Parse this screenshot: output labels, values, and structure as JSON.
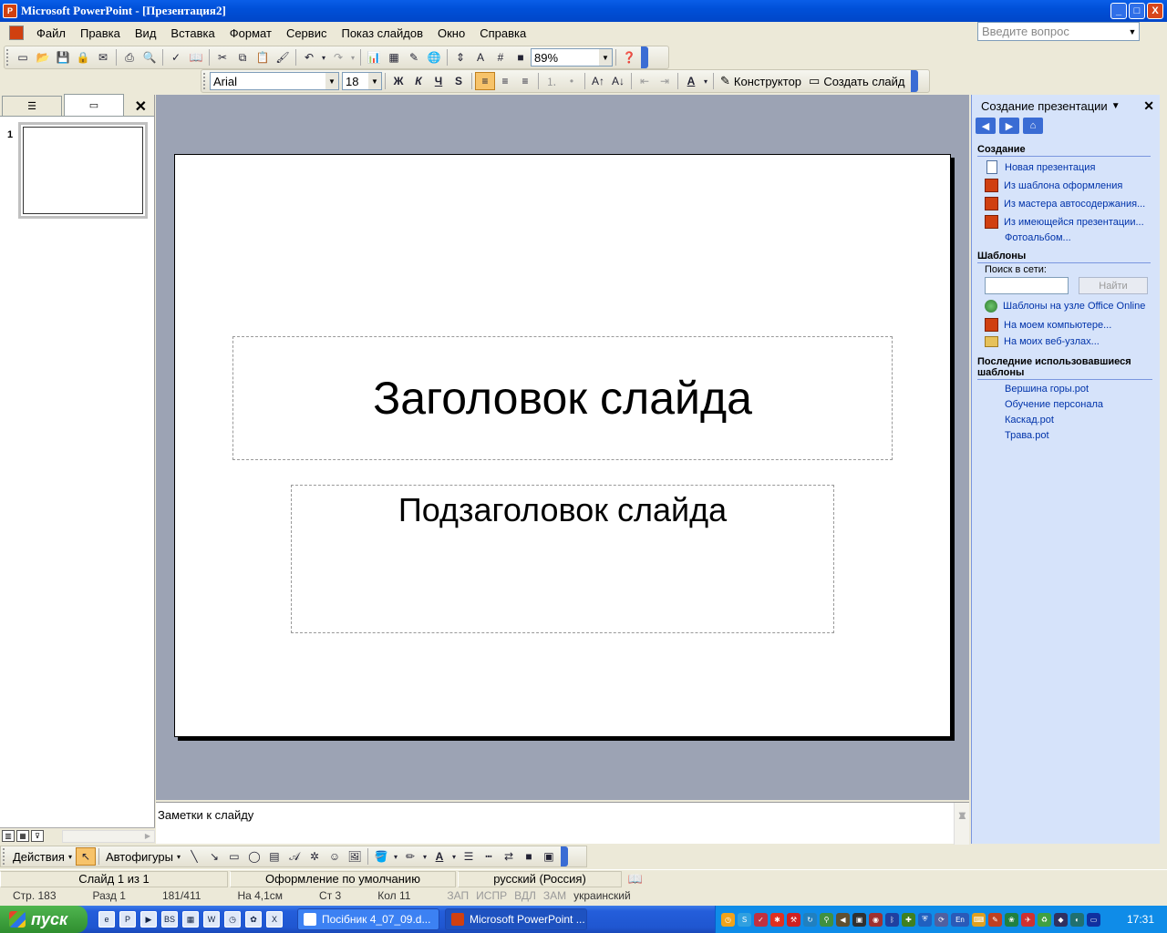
{
  "window": {
    "title": "Microsoft PowerPoint - [Презентация2]",
    "min_label": "_",
    "max_label": "□",
    "close_label": "X"
  },
  "menu": {
    "items": [
      "Файл",
      "Правка",
      "Вид",
      "Вставка",
      "Формат",
      "Сервис",
      "Показ слайдов",
      "Окно",
      "Справка"
    ],
    "ask_placeholder": "Введите вопрос"
  },
  "standard_toolbar": {
    "zoom": "89%"
  },
  "format_toolbar": {
    "font": "Arial",
    "font_size": "18",
    "bold": "Ж",
    "italic": "К",
    "underline": "Ч",
    "shadow": "S",
    "designer": "Конструктор",
    "new_slide": "Создать слайд"
  },
  "outline_pane": {
    "slide_number": "1"
  },
  "slide": {
    "title": "Заголовок слайда",
    "subtitle": "Подзаголовок слайда"
  },
  "notes": {
    "placeholder": "Заметки к слайду"
  },
  "task_pane": {
    "title": "Создание презентации",
    "section_create": "Создание",
    "create_links": [
      "Новая презентация",
      "Из шаблона оформления",
      "Из мастера автосодержания...",
      "Из имеющейся презентации...",
      "Фотоальбом..."
    ],
    "section_templates": "Шаблоны",
    "search_label": "Поиск в сети:",
    "search_button": "Найти",
    "template_links": [
      "Шаблоны на узле Office Online",
      "На моем компьютере...",
      "На моих веб-узлах..."
    ],
    "section_recent": "Последние использовавшиеся шаблоны",
    "recent_links": [
      "Вершина горы.pot",
      "Обучение персонала",
      "Каскад.pot",
      "Трава.pot"
    ]
  },
  "draw_toolbar": {
    "actions": "Действия",
    "autoshapes": "Автофигуры"
  },
  "status_bar": {
    "slide_pos": "Слайд 1 из 1",
    "design": "Оформление по умолчанию",
    "language": "русский (Россия)"
  },
  "background_status": {
    "items": [
      "Стр. 183",
      "Разд 1",
      "181/411",
      "На 4,1см",
      "Ст 3",
      "Кол 11",
      "ЗАП",
      "ИСПР",
      "ВДЛ",
      "ЗАМ",
      "украинский"
    ]
  },
  "taskbar": {
    "start": "пуск",
    "tasks": [
      "Посібник 4_07_09.d...",
      "Microsoft PowerPoint ..."
    ],
    "lang": "En",
    "clock": "17:31"
  }
}
